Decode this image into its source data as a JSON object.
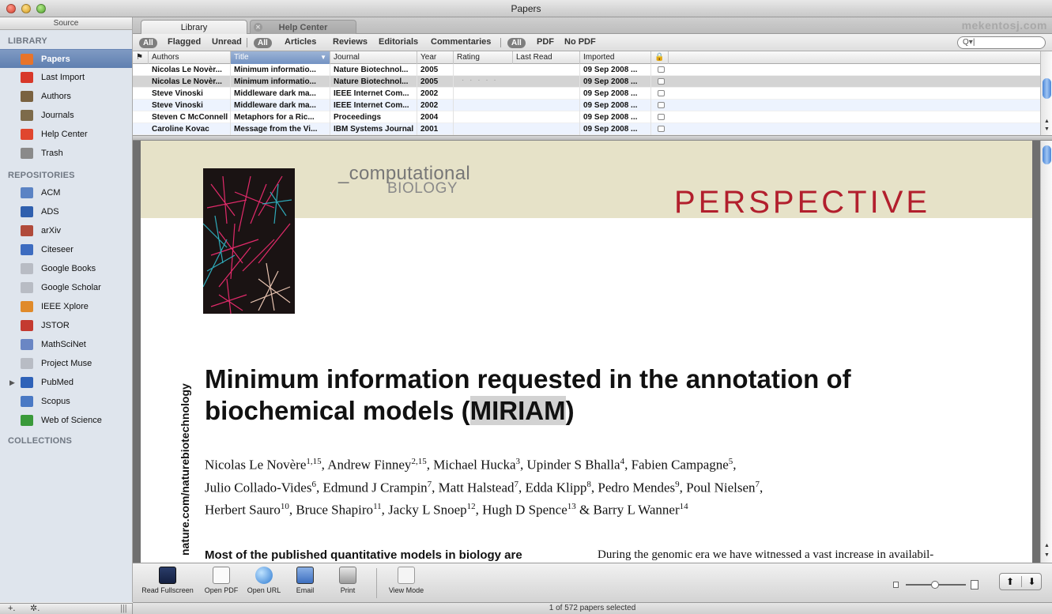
{
  "window": {
    "title": "Papers"
  },
  "sidebar": {
    "header": "Source",
    "library_title": "LIBRARY",
    "library_items": [
      {
        "label": "Papers",
        "icon": "papers-icon",
        "color": "#e8742a",
        "active": true
      },
      {
        "label": "Last Import",
        "icon": "last-import-icon",
        "color": "#d8382a"
      },
      {
        "label": "Authors",
        "icon": "authors-icon",
        "color": "#7a6240"
      },
      {
        "label": "Journals",
        "icon": "journals-icon",
        "color": "#7d6b4a"
      },
      {
        "label": "Help Center",
        "icon": "help-center-icon",
        "color": "#e0462e"
      },
      {
        "label": "Trash",
        "icon": "trash-icon",
        "color": "#8a8a8a"
      }
    ],
    "repositories_title": "REPOSITORIES",
    "repositories": [
      {
        "label": "ACM",
        "icon": "acm-icon",
        "color": "#5b83c4"
      },
      {
        "label": "ADS",
        "icon": "ads-icon",
        "color": "#2f5fae"
      },
      {
        "label": "arXiv",
        "icon": "arxiv-icon",
        "color": "#b04a3a"
      },
      {
        "label": "Citeseer",
        "icon": "citeseer-icon",
        "color": "#3d6cc0"
      },
      {
        "label": "Google Books",
        "icon": "google-books-icon",
        "color": "#b8bcc4"
      },
      {
        "label": "Google Scholar",
        "icon": "google-scholar-icon",
        "color": "#b8bcc4"
      },
      {
        "label": "IEEE Xplore",
        "icon": "ieee-xplore-icon",
        "color": "#e08a2a"
      },
      {
        "label": "JSTOR",
        "icon": "jstor-icon",
        "color": "#c43a30"
      },
      {
        "label": "MathSciNet",
        "icon": "mathscinet-icon",
        "color": "#6a86c4"
      },
      {
        "label": "Project Muse",
        "icon": "project-muse-icon",
        "color": "#b8bcc4"
      },
      {
        "label": "PubMed",
        "icon": "pubmed-icon",
        "color": "#2f62b8",
        "expandable": true
      },
      {
        "label": "Scopus",
        "icon": "scopus-icon",
        "color": "#4a79c4"
      },
      {
        "label": "Web of Science",
        "icon": "web-of-science-icon",
        "color": "#3a9a3a"
      }
    ],
    "collections_title": "COLLECTIONS",
    "footer": {
      "add": "+.",
      "gear": "✲.",
      "grip": "|||"
    }
  },
  "tabs": [
    {
      "label": "Library",
      "active": true
    },
    {
      "label": "Help Center",
      "active": false
    }
  ],
  "watermark": "mekentosj.com",
  "filters": {
    "all1": "All",
    "flagged": "Flagged",
    "unread": "Unread",
    "all2": "All",
    "articles": "Articles",
    "reviews": "Reviews",
    "editorials": "Editorials",
    "commentaries": "Commentaries",
    "all3": "All",
    "pdf": "PDF",
    "no_pdf": "No PDF",
    "search_placeholder": "Q▾"
  },
  "table": {
    "columns": [
      "Authors",
      "Title",
      "Journal",
      "Year",
      "Rating",
      "Last Read",
      "Imported"
    ],
    "rows": [
      {
        "authors": "Nicolas Le Novèr...",
        "title": "Minimum informatio...",
        "journal": "Nature Biotechnol...",
        "year": "2005",
        "last_read": "",
        "imported": "09 Sep 2008 ..."
      },
      {
        "authors": "Nicolas Le Novèr...",
        "title": "Minimum informatio...",
        "journal": "Nature Biotechnol...",
        "year": "2005",
        "last_read": "",
        "imported": "09 Sep 2008 ...",
        "selected": true
      },
      {
        "authors": "Steve Vinoski",
        "title": "Middleware dark ma...",
        "journal": "IEEE Internet Com...",
        "year": "2002",
        "last_read": "",
        "imported": "09 Sep 2008 ..."
      },
      {
        "authors": "Steve Vinoski",
        "title": "Middleware dark ma...",
        "journal": "IEEE Internet Com...",
        "year": "2002",
        "last_read": "",
        "imported": "09 Sep 2008 ..."
      },
      {
        "authors": "Steven C McConnell",
        "title": "Metaphors for a Ric...",
        "journal": "Proceedings",
        "year": "2004",
        "last_read": "",
        "imported": "09 Sep 2008 ..."
      },
      {
        "authors": "Caroline Kovac",
        "title": "Message from the Vi...",
        "journal": "IBM Systems Journal",
        "year": "2001",
        "last_read": "",
        "imported": "09 Sep 2008 ..."
      }
    ]
  },
  "document": {
    "series_top": "_computational",
    "series_bottom": "BIOLOGY",
    "section": "PERSPECTIVE",
    "site_vertical": "nature.com/naturebiotechnology",
    "title_line1": "Minimum information requested in the annotation of",
    "title_line2_pre": "biochemical models (",
    "title_line2_hl": "MIRIAM",
    "title_line2_post": ")",
    "authors_line1": [
      [
        "Nicolas Le Novère",
        "1,15"
      ],
      [
        "Andrew Finney",
        "2,15"
      ],
      [
        "Michael Hucka",
        "3"
      ],
      [
        "Upinder S Bhalla",
        "4"
      ],
      [
        "Fabien Campagne",
        "5"
      ]
    ],
    "authors_line2": [
      [
        "Julio Collado-Vides",
        "6"
      ],
      [
        "Edmund J Crampin",
        "7"
      ],
      [
        "Matt Halstead",
        "7"
      ],
      [
        "Edda Klipp",
        "8"
      ],
      [
        "Pedro Mendes",
        "9"
      ],
      [
        "Poul Nielsen",
        "7"
      ]
    ],
    "authors_line3": [
      [
        "Herbert Sauro",
        "10"
      ],
      [
        "Bruce Shapiro",
        "11"
      ],
      [
        "Jacky L Snoep",
        "12"
      ],
      [
        "Hugh D Spence",
        "13"
      ],
      [
        "Barry L Wanner",
        "14"
      ]
    ],
    "col1_text": "Most of the published quantitative models in biology are",
    "col2_text": "During the genomic era we have witnessed a vast increase in availabil-",
    "accent_color": "#b21f2d"
  },
  "toolbar": {
    "read_fullscreen": "Read Fullscreen",
    "open_pdf": "Open PDF",
    "open_url": "Open URL",
    "email": "Email",
    "print": "Print",
    "view_mode": "View Mode",
    "prev": "⬆",
    "next": "⬇"
  },
  "status": "1 of 572 papers selected"
}
